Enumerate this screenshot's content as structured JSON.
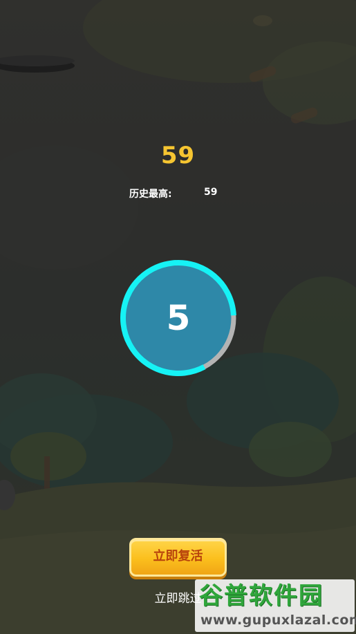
{
  "game": {
    "score": "59",
    "best_label": "历史最高:",
    "best_value": "59"
  },
  "countdown": {
    "number": "5",
    "progress_remaining_fraction": 0.82,
    "ring_color": "#16f2f5",
    "track_color": "#b4b4b4",
    "fill_color": "#2e88a8"
  },
  "buttons": {
    "revive_label": "立即复活",
    "skip_label": "立即跳过"
  },
  "watermark": {
    "main_text": "谷普软件园",
    "url_text": "www.gupuxlazal.com"
  },
  "colors": {
    "score": "#f6c531",
    "button_text": "#b8430c",
    "button_fill": "#fbbf1d"
  }
}
